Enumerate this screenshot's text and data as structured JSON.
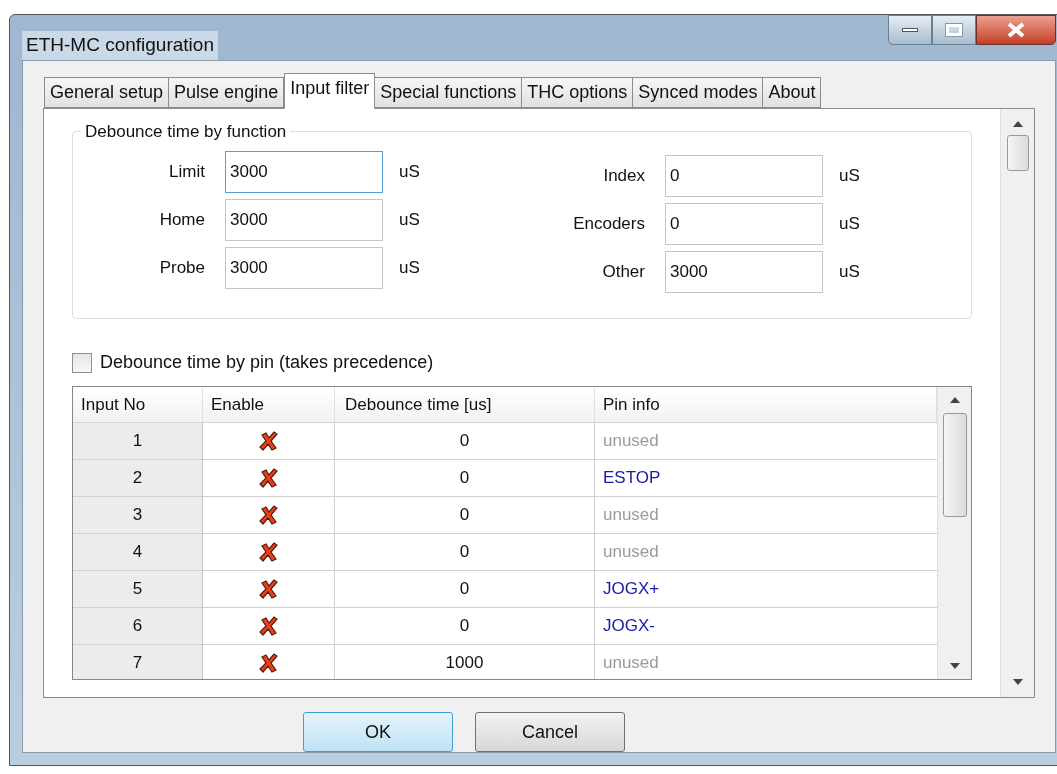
{
  "window": {
    "title": "ETH-MC configuration"
  },
  "tabs": [
    {
      "label": "General setup",
      "selected": false
    },
    {
      "label": "Pulse engine",
      "selected": false
    },
    {
      "label": "Input filter",
      "selected": true
    },
    {
      "label": "Special functions",
      "selected": false
    },
    {
      "label": "THC options",
      "selected": false
    },
    {
      "label": "Synced modes",
      "selected": false
    },
    {
      "label": "About",
      "selected": false
    }
  ],
  "function_group": {
    "title": "Debounce time by function",
    "fields": [
      {
        "label": "Limit",
        "value": "3000",
        "unit": "uS",
        "focused": true
      },
      {
        "label": "Index",
        "value": "0",
        "unit": "uS",
        "focused": false
      },
      {
        "label": "Home",
        "value": "3000",
        "unit": "uS",
        "focused": false
      },
      {
        "label": "Encoders",
        "value": "0",
        "unit": "uS",
        "focused": false
      },
      {
        "label": "Probe",
        "value": "3000",
        "unit": "uS",
        "focused": false
      },
      {
        "label": "Other",
        "value": "3000",
        "unit": "uS",
        "focused": false
      }
    ]
  },
  "pin_checkbox": {
    "label": "Debounce time by pin (takes precedence)",
    "checked": false
  },
  "table": {
    "columns": [
      "Input No",
      "Enable",
      "Debounce time [us]",
      "Pin info"
    ],
    "rows": [
      {
        "input": "1",
        "enabled": false,
        "time": "0",
        "pin_info": "unused",
        "assigned": false
      },
      {
        "input": "2",
        "enabled": false,
        "time": "0",
        "pin_info": "ESTOP",
        "assigned": true
      },
      {
        "input": "3",
        "enabled": false,
        "time": "0",
        "pin_info": "unused",
        "assigned": false
      },
      {
        "input": "4",
        "enabled": false,
        "time": "0",
        "pin_info": "unused",
        "assigned": false
      },
      {
        "input": "5",
        "enabled": false,
        "time": "0",
        "pin_info": "JOGX+",
        "assigned": true
      },
      {
        "input": "6",
        "enabled": false,
        "time": "0",
        "pin_info": "JOGX-",
        "assigned": true
      },
      {
        "input": "7",
        "enabled": false,
        "time": "1000",
        "pin_info": "unused",
        "assigned": false
      }
    ]
  },
  "buttons": [
    {
      "label": "OK",
      "default": true
    },
    {
      "label": "Cancel",
      "default": false
    }
  ]
}
